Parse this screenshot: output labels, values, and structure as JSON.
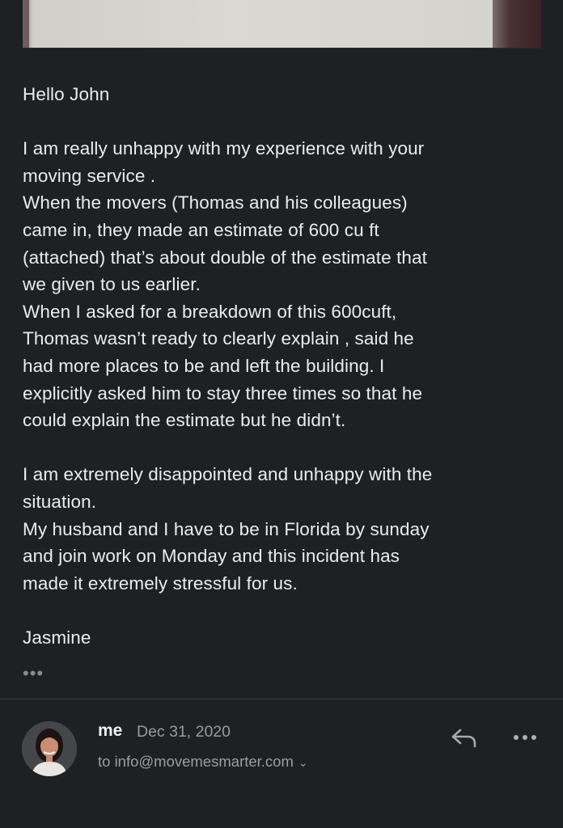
{
  "email_body": {
    "greeting": "Hello John",
    "paragraph1": [
      "I am really unhappy with my experience with your",
      "moving service .",
      "When the movers (Thomas and his colleagues)",
      "came in, they made an estimate of 600 cu ft",
      "(attached) that’s about double of the estimate that",
      "we given to us earlier.",
      "When I asked for a breakdown of this 600cuft,",
      "Thomas wasn’t ready to clearly explain , said he",
      "had more places to be and left the building. I",
      "explicitly asked him to stay three times so that he",
      "could explain the estimate but he didn’t."
    ],
    "paragraph2": [
      "I am extremely disappointed and unhappy with the",
      "situation.",
      "My husband and I have to be in Florida by sunday",
      "and join work on Monday and this incident has",
      "made it extremely stressful for us."
    ],
    "signature": "Jasmine",
    "trimmed_content_label": "•••"
  },
  "reply_header": {
    "sender": "me",
    "date": "Dec 31, 2020",
    "recipient": "to info@movemesmarter.com",
    "chevron": "⌄"
  },
  "icons": {
    "reply": "reply-icon",
    "more": "more-options-icon",
    "expand": "chevron-down-icon"
  },
  "colors": {
    "background": "#1f2023",
    "text": "#ececee",
    "muted": "#9a9aa0",
    "divider": "#3a3b3f"
  }
}
